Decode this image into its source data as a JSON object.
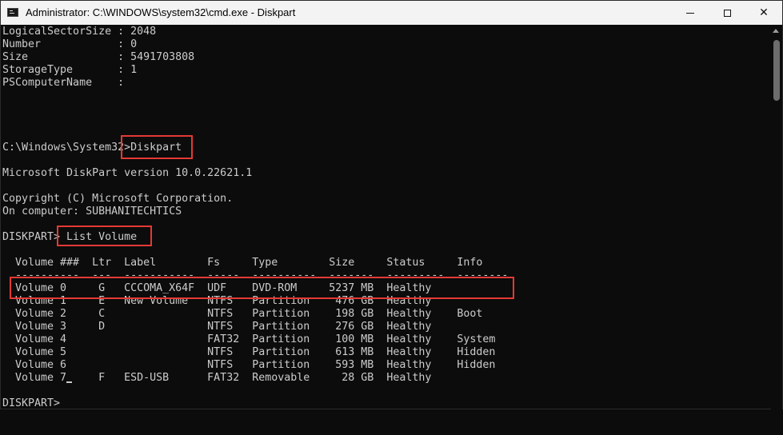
{
  "window": {
    "title": "Administrator: C:\\WINDOWS\\system32\\cmd.exe - Diskpart",
    "icon": "cmd-icon",
    "controls": {
      "minimize": "minimize-icon",
      "maximize": "maximize-icon",
      "close": "✕"
    }
  },
  "console": {
    "lines": [
      "LogicalSectorSize : 2048",
      "Number            : 0",
      "Size              : 5491703808",
      "StorageType       : 1",
      "PSComputerName    :",
      "",
      "",
      "",
      "",
      "C:\\Windows\\System32>Diskpart",
      "",
      "Microsoft DiskPart version 10.0.22621.1",
      "",
      "Copyright (C) Microsoft Corporation.",
      "On computer: SUBHANITECHTICS",
      "",
      "DISKPART> List Volume",
      "",
      "  Volume ###  Ltr  Label        Fs     Type        Size     Status     Info",
      "  ----------  ---  -----------  -----  ----------  -------  ---------  --------",
      "  Volume 0     G   CCCOMA_X64F  UDF    DVD-ROM     5237 MB  Healthy",
      "  Volume 1     E   New Volume   NTFS   Partition    476 GB  Healthy",
      "  Volume 2     C                NTFS   Partition    198 GB  Healthy    Boot",
      "  Volume 3     D                NTFS   Partition    276 GB  Healthy",
      "  Volume 4                      FAT32  Partition    100 MB  Healthy    System",
      "  Volume 5                      NTFS   Partition    613 MB  Healthy    Hidden",
      "  Volume 6                      NTFS   Partition    593 MB  Healthy    Hidden",
      "  Volume 7     F   ESD-USB      FAT32  Removable     28 GB  Healthy",
      "",
      "DISKPART> "
    ]
  },
  "colors": {
    "console_bg": "#0c0c0c",
    "console_text": "#cccccc",
    "titlebar_bg": "#f3f3f3",
    "annotation": "#e53935"
  }
}
